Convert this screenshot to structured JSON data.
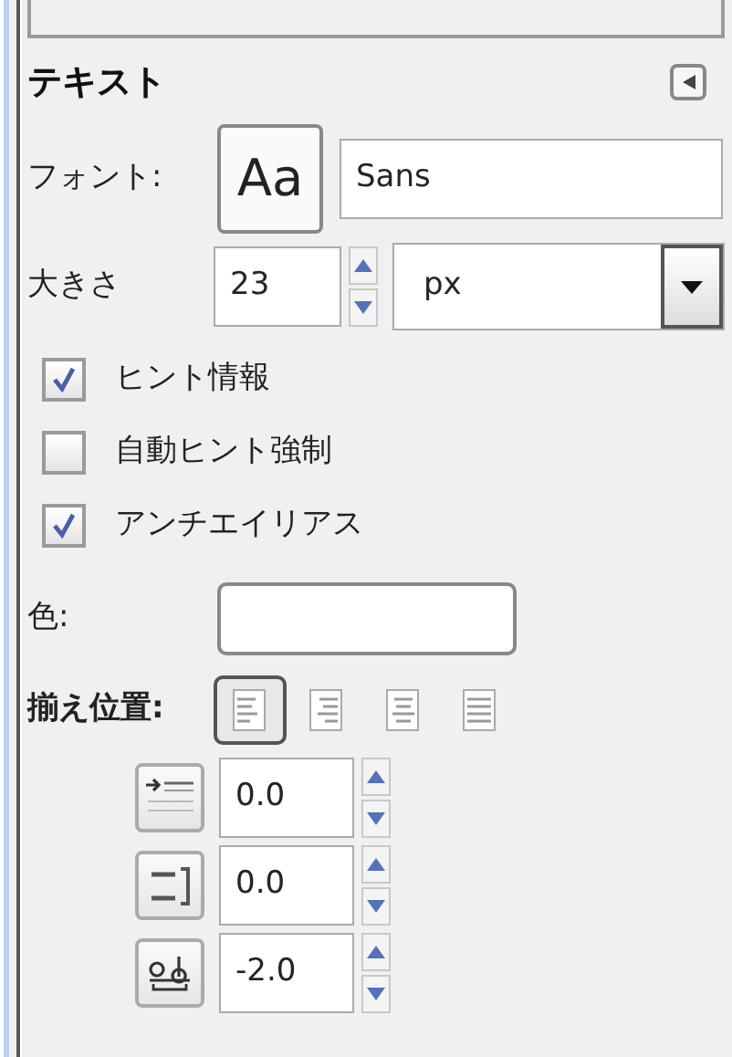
{
  "section": {
    "title": "テキスト"
  },
  "font": {
    "label": "フォント:",
    "preview": "Aa",
    "value": "Sans"
  },
  "size": {
    "label": "大きさ",
    "value": "23",
    "unit": "px"
  },
  "options": [
    {
      "label": "ヒント情報",
      "checked": true
    },
    {
      "label": "自動ヒント強制",
      "checked": false
    },
    {
      "label": "アンチエイリアス",
      "checked": true
    }
  ],
  "color": {
    "label": "色:"
  },
  "justify": {
    "label": "揃え位置:",
    "buttons": [
      {
        "kind": "left",
        "selected": true
      },
      {
        "kind": "right",
        "selected": false
      },
      {
        "kind": "center",
        "selected": false
      },
      {
        "kind": "fill",
        "selected": false
      }
    ]
  },
  "spacing": [
    {
      "kind": "indent",
      "value": "0.0"
    },
    {
      "kind": "line-spacing",
      "value": "0.0"
    },
    {
      "kind": "letter-spacing",
      "value": "-2.0"
    }
  ]
}
